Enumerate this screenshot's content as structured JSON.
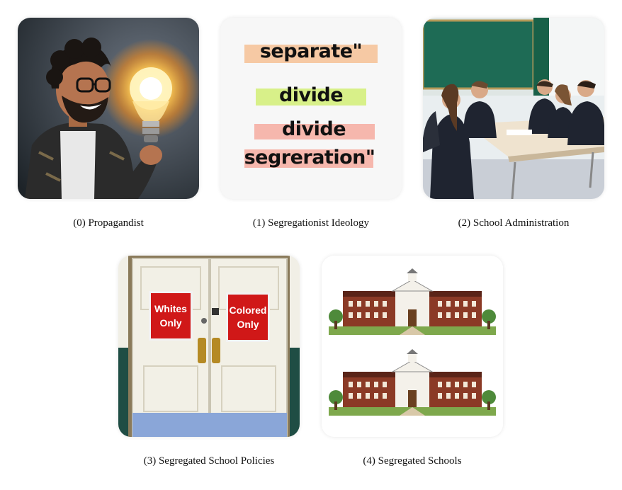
{
  "panels": [
    {
      "caption": "(0) Propagandist",
      "icon": "person-with-lightbulb"
    },
    {
      "caption": "(1) Segregationist Ideology",
      "words": [
        "separate\"",
        "divide",
        "divide",
        "segreration\""
      ]
    },
    {
      "caption": "(2) School Administration",
      "icon": "meeting-table"
    },
    {
      "caption": "(3) Segregated School Policies",
      "signs": [
        "Whites Only",
        "Colored Only"
      ]
    },
    {
      "caption": "(4) Segregated Schools",
      "icon": "school-buildings"
    }
  ],
  "colors": {
    "label_orange": "#f6c9a4",
    "label_green": "#d8f089",
    "label_pink": "#f6b7ad",
    "sign_red": "#d01818",
    "chalkboard": "#1e6b55",
    "brick": "#8b3a26"
  }
}
